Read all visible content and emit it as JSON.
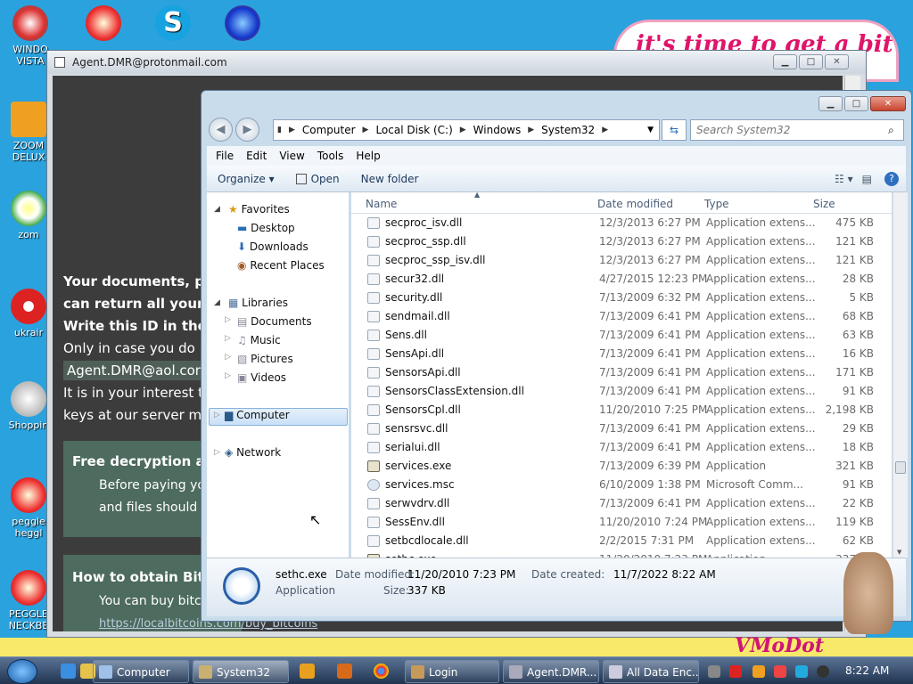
{
  "desktop": {
    "icons": [
      "WINDO VISTA",
      "ZOOM DELUX",
      "zom",
      "ukrair",
      "Shoppin",
      "peggle heggl",
      "PEGGLE NECKBE"
    ],
    "banner_top": "it's time to get a bit",
    "banner_bottom": "VMoDot"
  },
  "ransom": {
    "title": "Agent.DMR@protonmail.com",
    "line1": "Your documents, pho",
    "line2": "can return all your fi",
    "line3": "Write this ID in the s",
    "line4": "Only in case you do not",
    "email": "Agent.DMR@aol.com",
    "line5": "It is in your interest to r",
    "line6": "keys at our server more",
    "box1_title": "Free decryption as",
    "box1_line1": "Before paying you",
    "box1_line2": "and files should n",
    "box2_title": "How to obtain Bitco",
    "box2_line1": "You can buy bitco",
    "box2_link": "https://localbitcoins.com/buy_bitcoins"
  },
  "explorer": {
    "breadcrumb": [
      "Computer",
      "Local Disk (C:)",
      "Windows",
      "System32"
    ],
    "search_placeholder": "Search System32",
    "menu": [
      "File",
      "Edit",
      "View",
      "Tools",
      "Help"
    ],
    "toolbar": {
      "organize": "Organize",
      "open": "Open",
      "new_folder": "New folder"
    },
    "nav": {
      "favorites": "Favorites",
      "desktop": "Desktop",
      "downloads": "Downloads",
      "recent": "Recent Places",
      "libraries": "Libraries",
      "documents": "Documents",
      "music": "Music",
      "pictures": "Pictures",
      "videos": "Videos",
      "computer": "Computer",
      "network": "Network"
    },
    "columns": {
      "name": "Name",
      "date": "Date modified",
      "type": "Type",
      "size": "Size"
    },
    "files": [
      {
        "name": "secproc_isv.dll",
        "date": "12/3/2013 6:27 PM",
        "type": "Application extens...",
        "size": "475 KB"
      },
      {
        "name": "secproc_ssp.dll",
        "date": "12/3/2013 6:27 PM",
        "type": "Application extens...",
        "size": "121 KB"
      },
      {
        "name": "secproc_ssp_isv.dll",
        "date": "12/3/2013 6:27 PM",
        "type": "Application extens...",
        "size": "121 KB"
      },
      {
        "name": "secur32.dll",
        "date": "4/27/2015 12:23 PM",
        "type": "Application extens...",
        "size": "28 KB"
      },
      {
        "name": "security.dll",
        "date": "7/13/2009 6:32 PM",
        "type": "Application extens...",
        "size": "5 KB"
      },
      {
        "name": "sendmail.dll",
        "date": "7/13/2009 6:41 PM",
        "type": "Application extens...",
        "size": "68 KB"
      },
      {
        "name": "Sens.dll",
        "date": "7/13/2009 6:41 PM",
        "type": "Application extens...",
        "size": "63 KB"
      },
      {
        "name": "SensApi.dll",
        "date": "7/13/2009 6:41 PM",
        "type": "Application extens...",
        "size": "16 KB"
      },
      {
        "name": "SensorsApi.dll",
        "date": "7/13/2009 6:41 PM",
        "type": "Application extens...",
        "size": "171 KB"
      },
      {
        "name": "SensorsClassExtension.dll",
        "date": "7/13/2009 6:41 PM",
        "type": "Application extens...",
        "size": "91 KB"
      },
      {
        "name": "SensorsCpl.dll",
        "date": "11/20/2010 7:25 PM",
        "type": "Application extens...",
        "size": "2,198 KB"
      },
      {
        "name": "sensrsvc.dll",
        "date": "7/13/2009 6:41 PM",
        "type": "Application extens...",
        "size": "29 KB"
      },
      {
        "name": "serialui.dll",
        "date": "7/13/2009 6:41 PM",
        "type": "Application extens...",
        "size": "18 KB"
      },
      {
        "name": "services.exe",
        "date": "7/13/2009 6:39 PM",
        "type": "Application",
        "size": "321 KB"
      },
      {
        "name": "services.msc",
        "date": "6/10/2009 1:38 PM",
        "type": "Microsoft Comm...",
        "size": "91 KB"
      },
      {
        "name": "serwvdrv.dll",
        "date": "7/13/2009 6:41 PM",
        "type": "Application extens...",
        "size": "22 KB"
      },
      {
        "name": "SessEnv.dll",
        "date": "11/20/2010 7:24 PM",
        "type": "Application extens...",
        "size": "119 KB"
      },
      {
        "name": "setbcdlocale.dll",
        "date": "2/2/2015 7:31 PM",
        "type": "Application extens...",
        "size": "62 KB"
      },
      {
        "name": "sethc.exe",
        "date": "11/20/2010 7:23 PM",
        "type": "Application",
        "size": "337 KB"
      }
    ],
    "details": {
      "name": "sethc.exe",
      "type": "Application",
      "modified_label": "Date modified:",
      "modified": "11/20/2010 7:23 PM",
      "created_label": "Date created:",
      "created": "11/7/2022 8:22 AM",
      "size_label": "Size:",
      "size": "337 KB"
    }
  },
  "taskbar": {
    "tasks": [
      "Computer",
      "System32",
      "Login",
      "Agent.DMR...",
      "All Data Enc..."
    ],
    "time": "8:22 AM"
  },
  "colors": {
    "desktop": "#2aa2de",
    "ransom_bg": "#3c3c3c",
    "ransom_box": "#4d6b5e",
    "selection": "#c9e0f7"
  }
}
